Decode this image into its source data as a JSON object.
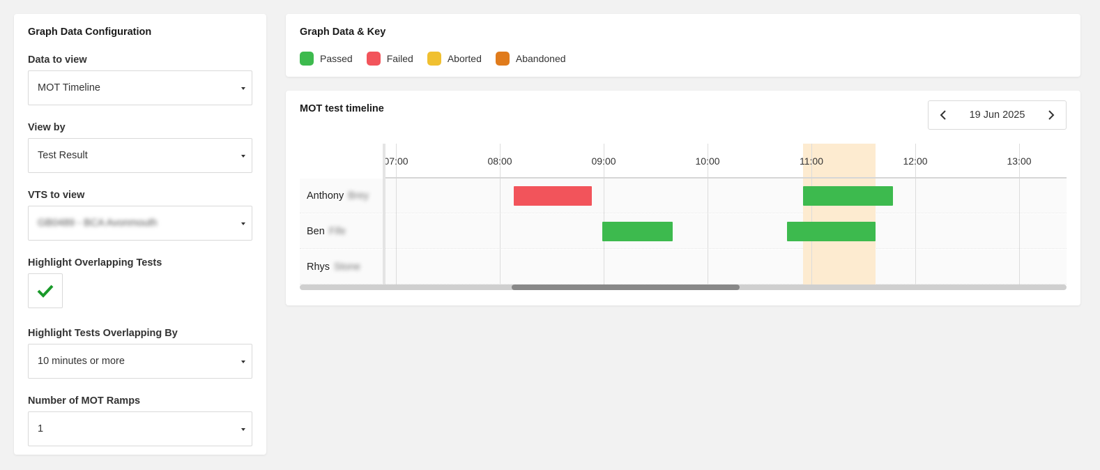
{
  "config": {
    "title": "Graph Data Configuration",
    "data_to_view": {
      "label": "Data to view",
      "value": "MOT Timeline"
    },
    "view_by": {
      "label": "View by",
      "value": "Test Result"
    },
    "vts_to_view": {
      "label": "VTS to view",
      "value": "GB0489 - BCA Avonmouth"
    },
    "highlight_overlapping": {
      "label": "Highlight Overlapping Tests",
      "checked": true
    },
    "overlap_by": {
      "label": "Highlight Tests Overlapping By",
      "value": "10 minutes or more"
    },
    "ramps": {
      "label": "Number of MOT Ramps",
      "value": "1"
    }
  },
  "key": {
    "title": "Graph Data & Key",
    "items": [
      {
        "label": "Passed",
        "color": "#3dba4e"
      },
      {
        "label": "Failed",
        "color": "#f2545b"
      },
      {
        "label": "Aborted",
        "color": "#f0c030"
      },
      {
        "label": "Abandoned",
        "color": "#e07b1c"
      }
    ]
  },
  "timeline": {
    "title": "MOT test timeline",
    "date": "19 Jun 2025",
    "icons": {
      "prev": "chevron-left-icon",
      "next": "chevron-right-icon"
    }
  },
  "chart_data": {
    "type": "gantt",
    "x_ticks": [
      "07:00",
      "08:00",
      "09:00",
      "10:00",
      "11:00",
      "12:00",
      "13:00"
    ],
    "rows": [
      {
        "first": "Anthony",
        "last": "Brey"
      },
      {
        "first": "Ben",
        "last": "Fife"
      },
      {
        "first": "Rhys",
        "last": "Stone"
      }
    ],
    "tests": [
      {
        "row": 0,
        "start": "08:08",
        "end": "08:53",
        "result": "Failed"
      },
      {
        "row": 0,
        "start": "10:55",
        "end": "11:47",
        "result": "Passed"
      },
      {
        "row": 1,
        "start": "08:59",
        "end": "09:40",
        "result": "Passed"
      },
      {
        "row": 1,
        "start": "10:46",
        "end": "11:37",
        "result": "Passed"
      }
    ],
    "overlap_window": {
      "start": "10:55",
      "end": "11:37"
    },
    "result_colors": {
      "Passed": "#3dba4e",
      "Failed": "#f2545b",
      "Aborted": "#f0c030",
      "Abandoned": "#e07b1c"
    }
  }
}
